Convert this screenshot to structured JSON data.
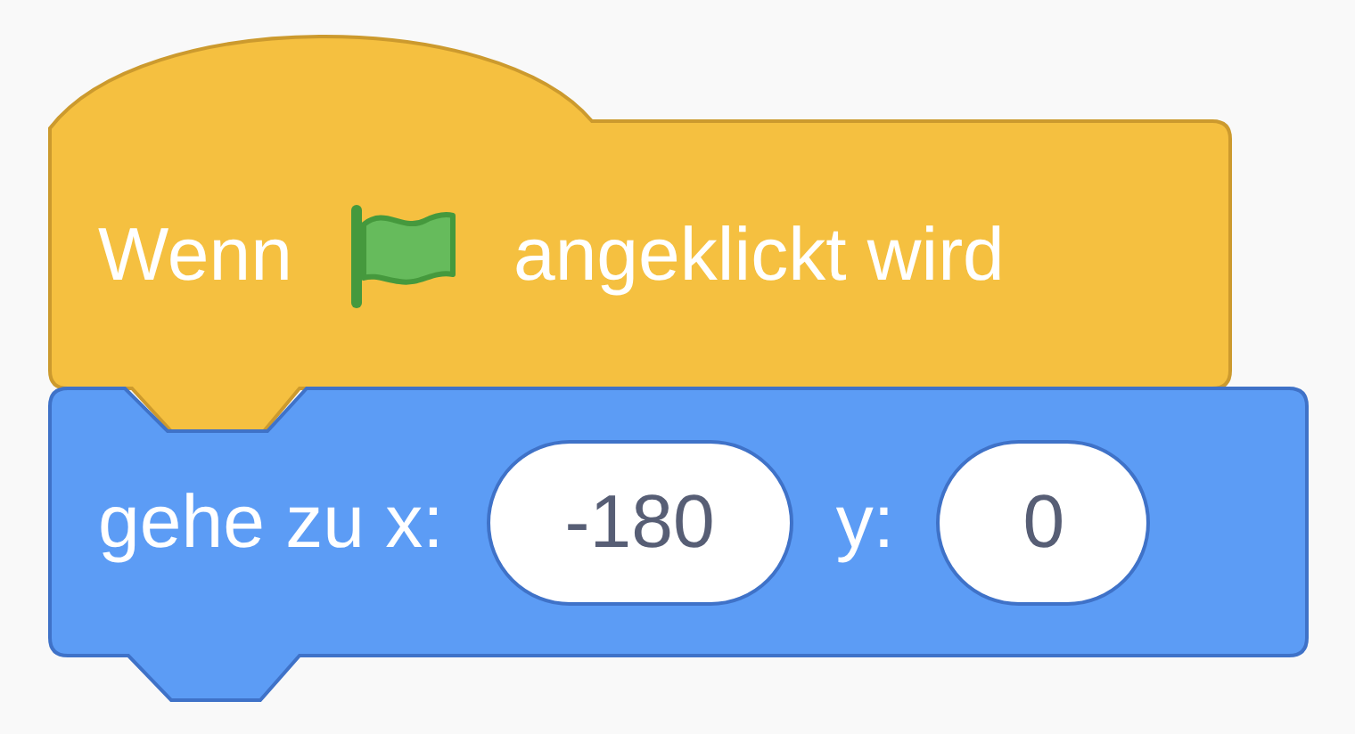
{
  "blocks": [
    {
      "kind": "hat",
      "parts": [
        {
          "kind": "text",
          "text": "Wenn"
        },
        {
          "kind": "flag"
        },
        {
          "kind": "text",
          "text": "angeklickt wird"
        }
      ]
    },
    {
      "kind": "stack",
      "parts": [
        {
          "kind": "text",
          "text": "gehe zu x:"
        },
        {
          "kind": "number",
          "value": "-180"
        },
        {
          "kind": "text",
          "text": "y:"
        },
        {
          "kind": "number",
          "value": "0"
        }
      ]
    }
  ]
}
